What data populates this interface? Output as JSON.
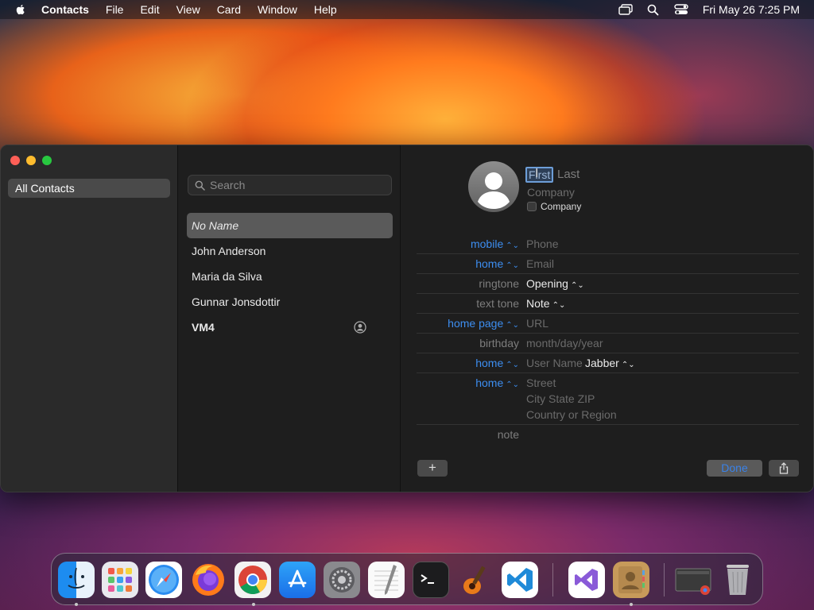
{
  "menubar": {
    "app_name": "Contacts",
    "items": [
      "File",
      "Edit",
      "View",
      "Card",
      "Window",
      "Help"
    ],
    "clock": "Fri May 26  7:25 PM",
    "icons": [
      "screen-mirroring-icon",
      "spotlight-search-icon",
      "control-center-icon"
    ]
  },
  "sidebar": {
    "group": "All Contacts"
  },
  "search": {
    "placeholder": "Search"
  },
  "contacts": [
    {
      "name": "No Name",
      "selected": true
    },
    {
      "name": "John Anderson"
    },
    {
      "name": "Maria da Silva"
    },
    {
      "name": "Gunnar Jonsdottir"
    },
    {
      "name": "VM4",
      "me_card": true
    }
  ],
  "card": {
    "first_placeholder": "First",
    "last_placeholder": "Last",
    "company_placeholder": "Company",
    "company_checkbox_label": "Company",
    "fields": [
      {
        "label": "mobile",
        "value": "Phone"
      },
      {
        "label": "home",
        "value": "Email"
      },
      {
        "label": "ringtone",
        "value": "Opening"
      },
      {
        "label": "text tone",
        "value": "Note"
      },
      {
        "label": "home page",
        "value": "URL"
      },
      {
        "label": "birthday",
        "value": "month/day/year"
      },
      {
        "label": "home",
        "value": "User Name",
        "service": "Jabber"
      },
      {
        "label": "home",
        "lines": [
          "Street",
          "City  State  ZIP",
          "Country or Region"
        ]
      },
      {
        "label": "note",
        "value": ""
      }
    ],
    "add_button": "+",
    "done_button": "Done"
  },
  "dock": {
    "apps": [
      "Finder",
      "Launchpad",
      "Safari",
      "Firefox",
      "Google Chrome",
      "App Store",
      "System Preferences",
      "TextEdit",
      "Terminal",
      "GarageBand",
      "Visual Studio Code",
      "Visual Studio",
      "Contacts",
      "Chrome Window",
      "Trash"
    ]
  },
  "colors": {
    "accent_blue": "#3d8ef0",
    "selection": "#5a5a5a",
    "close": "#fe5f57",
    "minimize": "#febc2e",
    "maximize": "#28c840"
  }
}
